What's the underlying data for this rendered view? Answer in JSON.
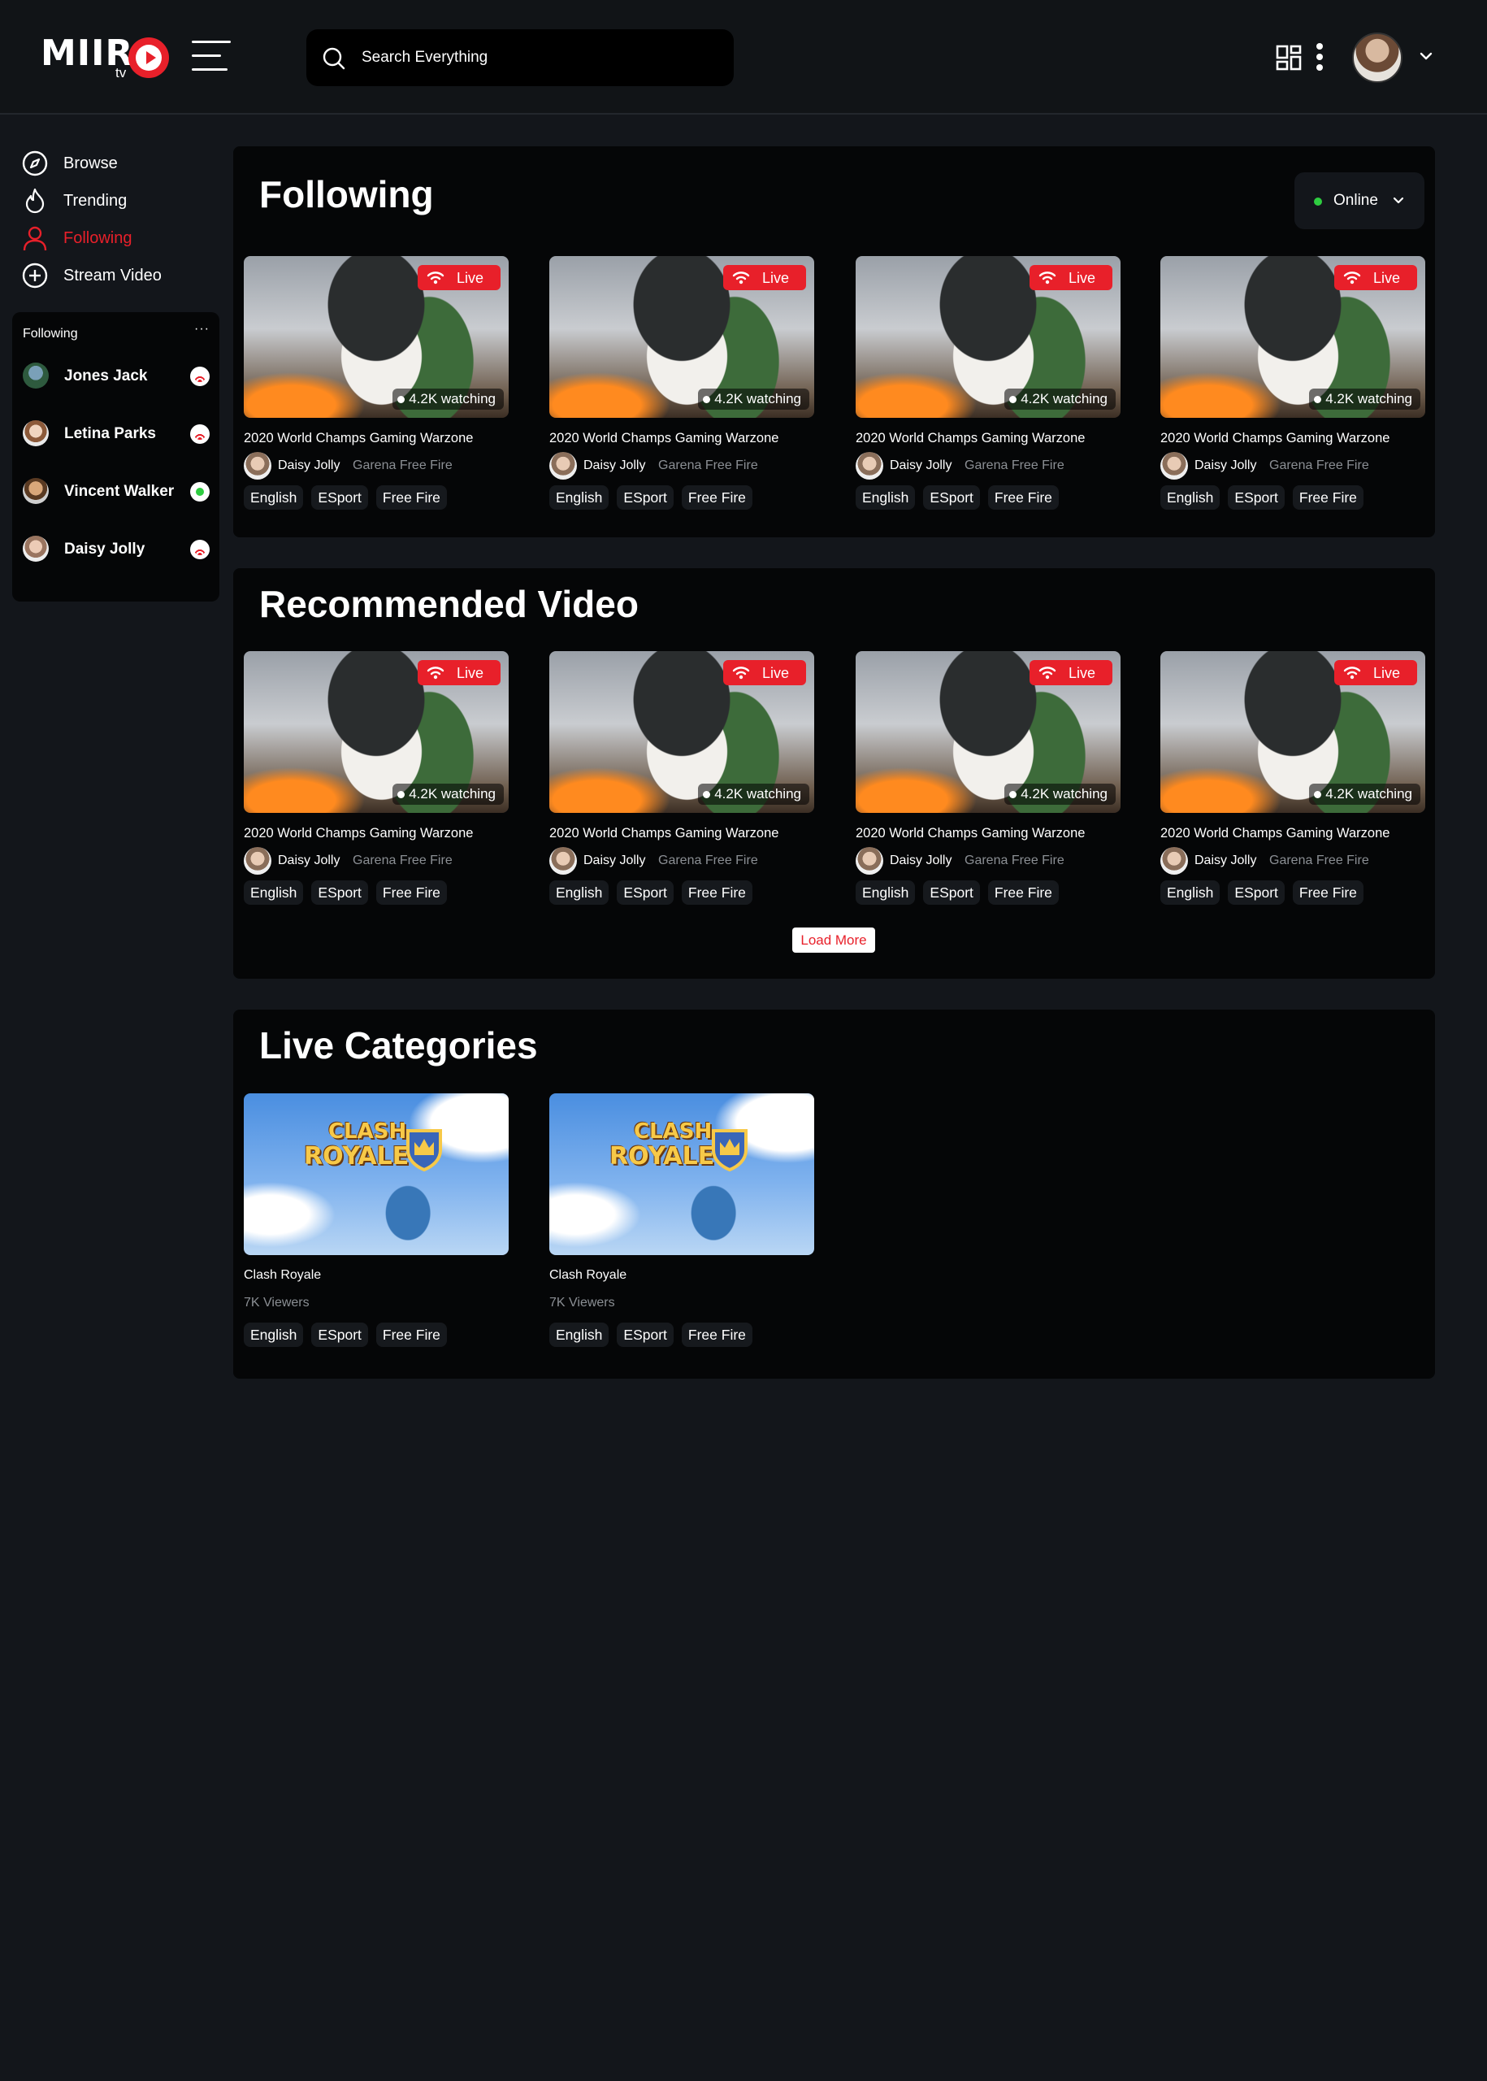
{
  "brand": {
    "name": "MIIR",
    "suffix": "tv",
    "accent": "#e8202a"
  },
  "search": {
    "placeholder": "Search Everything"
  },
  "nav": [
    {
      "label": "Browse",
      "icon": "compass-icon"
    },
    {
      "label": "Trending",
      "icon": "flame-icon"
    },
    {
      "label": "Following",
      "icon": "user-icon",
      "active": true
    },
    {
      "label": "Stream Video",
      "icon": "plus-circle-icon"
    }
  ],
  "following_panel": {
    "title": "Following",
    "more": "···",
    "users": [
      {
        "name": "Jones Jack",
        "status": "live"
      },
      {
        "name": "Letina Parks",
        "status": "live"
      },
      {
        "name": "Vincent Walker",
        "status": "online"
      },
      {
        "name": "Daisy Jolly",
        "status": "live"
      }
    ]
  },
  "following_section": {
    "title": "Following",
    "filter": "Online",
    "cards": [
      {
        "live": "Live",
        "watching": "4.2K watching",
        "title": "2020 World Champs Gaming Warzone",
        "user": "Daisy Jolly",
        "game": "Garena Free Fire",
        "tags": [
          "English",
          "ESport",
          "Free Fire"
        ]
      },
      {
        "live": "Live",
        "watching": "4.2K watching",
        "title": "2020 World Champs Gaming Warzone",
        "user": "Daisy Jolly",
        "game": "Garena Free Fire",
        "tags": [
          "English",
          "ESport",
          "Free Fire"
        ]
      },
      {
        "live": "Live",
        "watching": "4.2K watching",
        "title": "2020 World Champs Gaming Warzone",
        "user": "Daisy Jolly",
        "game": "Garena Free Fire",
        "tags": [
          "English",
          "ESport",
          "Free Fire"
        ]
      },
      {
        "live": "Live",
        "watching": "4.2K watching",
        "title": "2020 World Champs Gaming Warzone",
        "user": "Daisy Jolly",
        "game": "Garena Free Fire",
        "tags": [
          "English",
          "ESport",
          "Free Fire"
        ]
      }
    ]
  },
  "recommended_section": {
    "title": "Recommended Video",
    "load_more": "Load More",
    "cards": [
      {
        "live": "Live",
        "watching": "4.2K watching",
        "title": "2020 World Champs Gaming Warzone",
        "user": "Daisy Jolly",
        "game": "Garena Free Fire",
        "tags": [
          "English",
          "ESport",
          "Free Fire"
        ]
      },
      {
        "live": "Live",
        "watching": "4.2K watching",
        "title": "2020 World Champs Gaming Warzone",
        "user": "Daisy Jolly",
        "game": "Garena Free Fire",
        "tags": [
          "English",
          "ESport",
          "Free Fire"
        ]
      },
      {
        "live": "Live",
        "watching": "4.2K watching",
        "title": "2020 World Champs Gaming Warzone",
        "user": "Daisy Jolly",
        "game": "Garena Free Fire",
        "tags": [
          "English",
          "ESport",
          "Free Fire"
        ]
      },
      {
        "live": "Live",
        "watching": "4.2K watching",
        "title": "2020 World Champs Gaming Warzone",
        "user": "Daisy Jolly",
        "game": "Garena Free Fire",
        "tags": [
          "English",
          "ESport",
          "Free Fire"
        ]
      }
    ]
  },
  "categories_section": {
    "title": "Live Categories",
    "cards": [
      {
        "logo_top": "CLASH",
        "logo_bottom": "ROYALE",
        "title": "Clash Royale",
        "viewers": "7K Viewers",
        "tags": [
          "English",
          "ESport",
          "Free Fire"
        ]
      },
      {
        "logo_top": "CLASH",
        "logo_bottom": "ROYALE",
        "title": "Clash Royale",
        "viewers": "7K Viewers",
        "tags": [
          "English",
          "ESport",
          "Free Fire"
        ]
      }
    ]
  }
}
